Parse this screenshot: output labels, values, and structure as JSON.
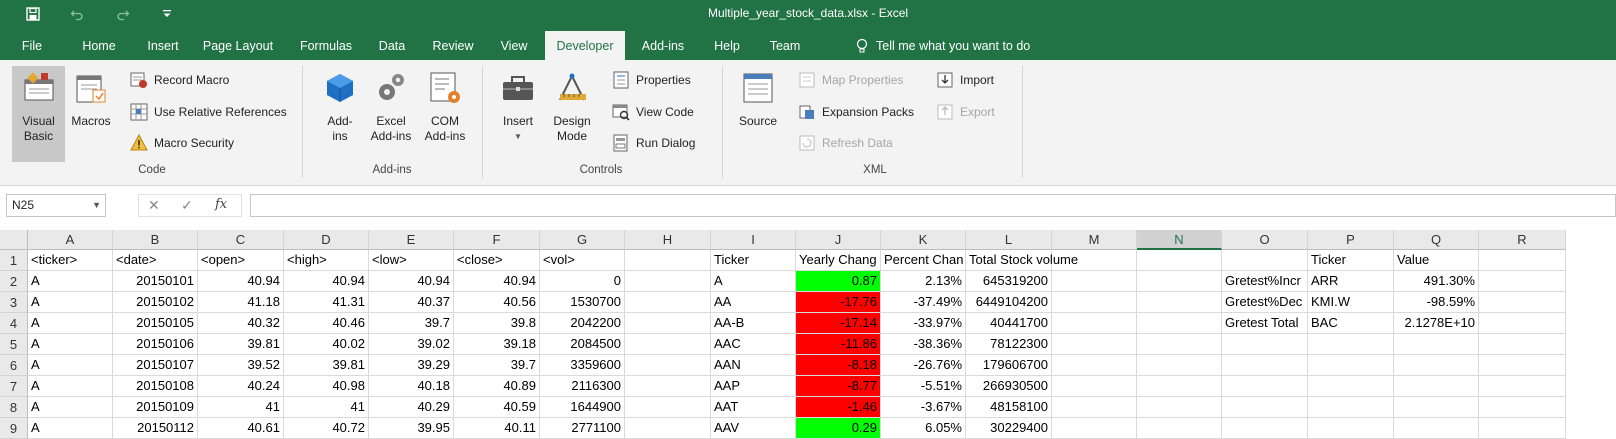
{
  "window": {
    "title": "Multiple_year_stock_data.xlsx  -  Excel"
  },
  "qat": {
    "icons": [
      "save-icon",
      "undo-icon",
      "redo-icon",
      "customize-qat-icon"
    ]
  },
  "tabs": [
    "File",
    "Home",
    "Insert",
    "Page Layout",
    "Formulas",
    "Data",
    "Review",
    "View",
    "Developer",
    "Add-ins",
    "Help",
    "Team"
  ],
  "active_tab": "Developer",
  "tell_me": "Tell me what you want to do",
  "ribbon": {
    "code": {
      "label": "Code",
      "visual_basic": "Visual\nBasic",
      "macros": "Macros",
      "record_macro": "Record Macro",
      "use_relative": "Use Relative References",
      "macro_security": "Macro Security"
    },
    "addins": {
      "label": "Add-ins",
      "addins": "Add-\nins",
      "excel_addins": "Excel\nAdd-ins",
      "com_addins": "COM\nAdd-ins"
    },
    "controls": {
      "label": "Controls",
      "insert": "Insert",
      "design_mode": "Design\nMode",
      "properties": "Properties",
      "view_code": "View Code",
      "run_dialog": "Run Dialog"
    },
    "xml": {
      "label": "XML",
      "source": "Source",
      "map_properties": "Map Properties",
      "expansion_packs": "Expansion Packs",
      "refresh_data": "Refresh Data",
      "import": "Import",
      "export": "Export"
    }
  },
  "formula_bar": {
    "name_box": "N25",
    "cancel": "✕",
    "enter": "✓",
    "fx": "fx",
    "value": ""
  },
  "sheet": {
    "columns": [
      "A",
      "B",
      "C",
      "D",
      "E",
      "F",
      "G",
      "H",
      "I",
      "J",
      "K",
      "L",
      "M",
      "N",
      "O",
      "P",
      "Q",
      "R"
    ],
    "selected_column": "N",
    "rows": [
      "1",
      "2",
      "3",
      "4",
      "5",
      "6",
      "7",
      "8",
      "9"
    ],
    "cells": [
      [
        "<ticker>",
        "<date>",
        "<open>",
        "<high>",
        "<low>",
        "<close>",
        "<vol>",
        "",
        "Ticker",
        "Yearly Chang",
        "Percent Chan",
        "Total Stock volume",
        "",
        "",
        "",
        "Ticker",
        "Value",
        ""
      ],
      [
        "A",
        "20150101",
        "40.94",
        "40.94",
        "40.94",
        "40.94",
        "0",
        "",
        "A",
        "0.87",
        "2.13%",
        "645319200",
        "",
        "",
        "Gretest%Incr",
        "ARR",
        "491.30%",
        ""
      ],
      [
        "A",
        "20150102",
        "41.18",
        "41.31",
        "40.37",
        "40.56",
        "1530700",
        "",
        "AA",
        "-17.76",
        "-37.49%",
        "6449104200",
        "",
        "",
        "Gretest%Dec",
        "KMI.W",
        "-98.59%",
        ""
      ],
      [
        "A",
        "20150105",
        "40.32",
        "40.46",
        "39.7",
        "39.8",
        "2042200",
        "",
        "AA-B",
        "-17.14",
        "-33.97%",
        "40441700",
        "",
        "",
        "Gretest Total",
        "BAC",
        "2.1278E+10",
        ""
      ],
      [
        "A",
        "20150106",
        "39.81",
        "40.02",
        "39.02",
        "39.18",
        "2084500",
        "",
        "AAC",
        "-11.86",
        "-38.36%",
        "78122300",
        "",
        "",
        "",
        "",
        "",
        ""
      ],
      [
        "A",
        "20150107",
        "39.52",
        "39.81",
        "39.29",
        "39.7",
        "3359600",
        "",
        "AAN",
        "-8.18",
        "-26.76%",
        "179606700",
        "",
        "",
        "",
        "",
        "",
        ""
      ],
      [
        "A",
        "20150108",
        "40.24",
        "40.98",
        "40.18",
        "40.89",
        "2116300",
        "",
        "AAP",
        "-8.77",
        "-5.51%",
        "266930500",
        "",
        "",
        "",
        "",
        "",
        ""
      ],
      [
        "A",
        "20150109",
        "41",
        "41",
        "40.29",
        "40.59",
        "1644900",
        "",
        "AAT",
        "-1.46",
        "-3.67%",
        "48158100",
        "",
        "",
        "",
        "",
        "",
        ""
      ],
      [
        "A",
        "20150112",
        "40.61",
        "40.72",
        "39.95",
        "40.11",
        "2771100",
        "",
        "AAV",
        "0.29",
        "6.05%",
        "30229400",
        "",
        "",
        "",
        "",
        "",
        ""
      ]
    ],
    "fill_colors": {
      "positive": "#00ff00",
      "negative": "#ff0000"
    }
  },
  "colors": {
    "excel_green": "#217346",
    "ribbon_bg": "#f3f3f3"
  }
}
